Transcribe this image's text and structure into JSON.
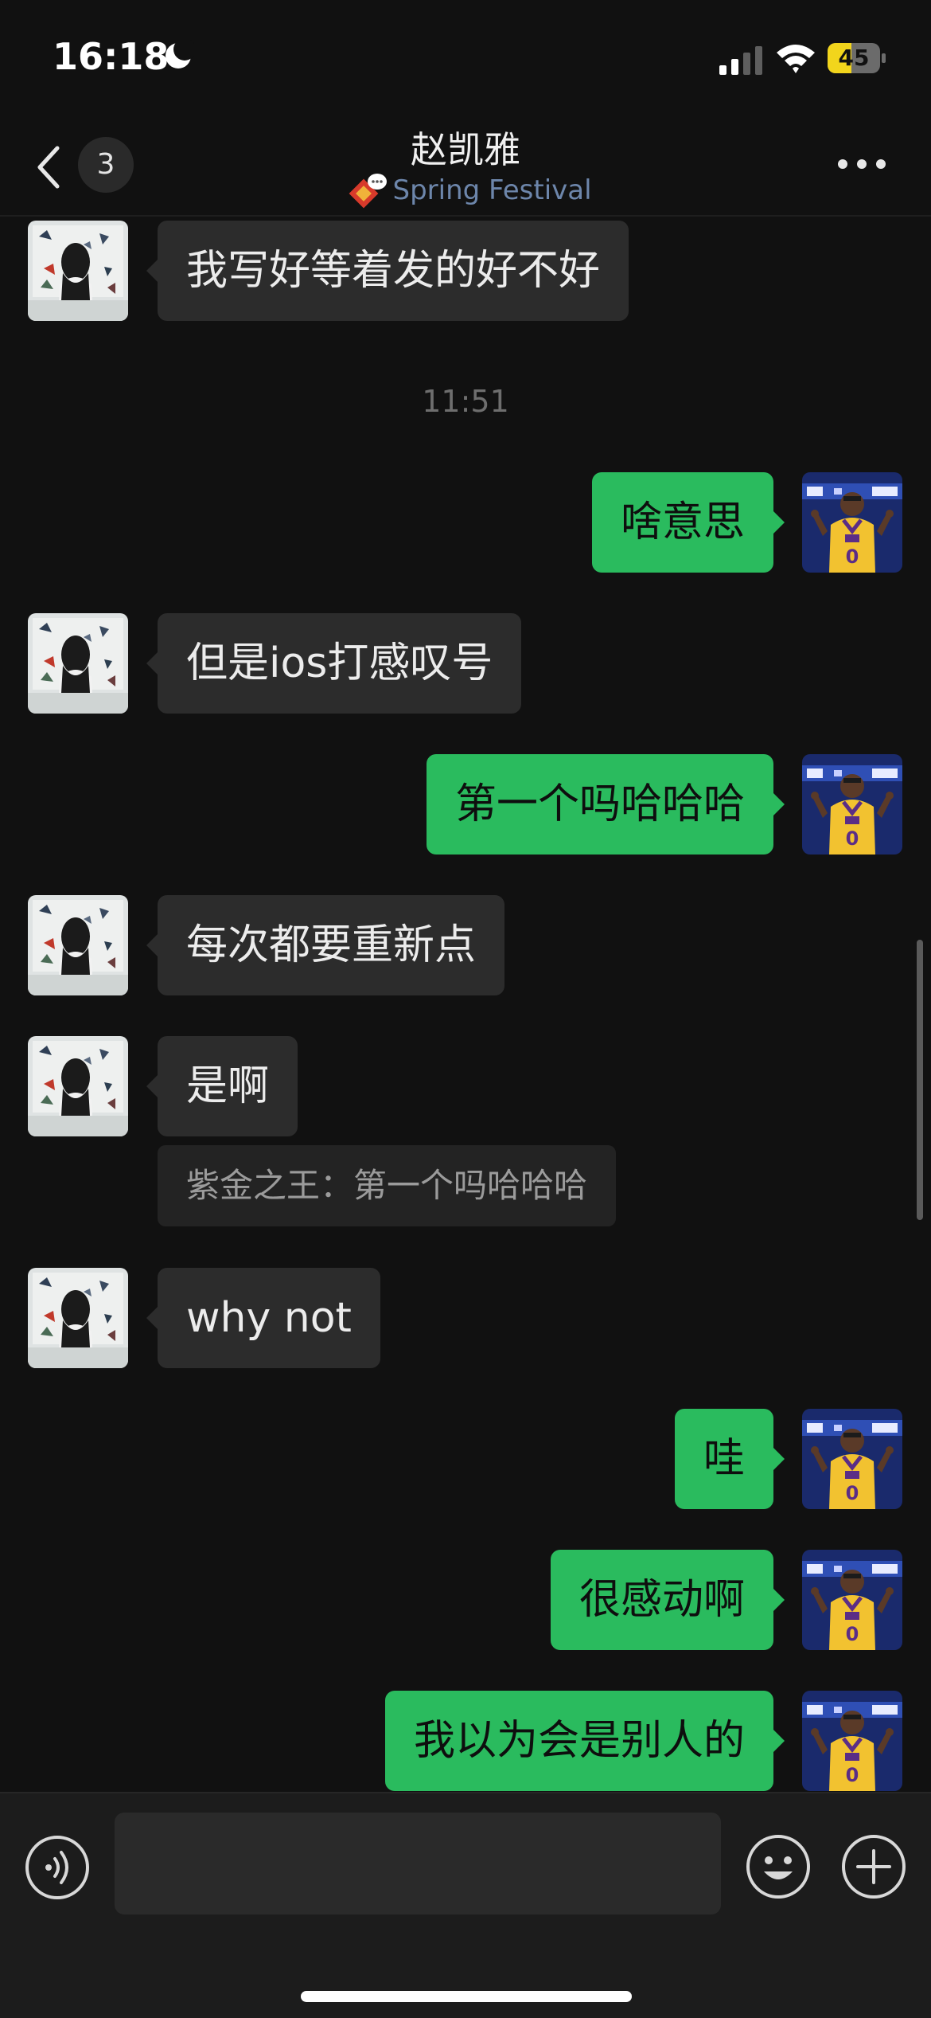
{
  "status_bar": {
    "time": "16:18",
    "battery": "45",
    "battery_level": 0.45
  },
  "header": {
    "back_count": "3",
    "title": "赵凯雅",
    "status_text": "Spring Festival"
  },
  "messages": [
    {
      "text": "我写好等着发的好不好",
      "from": "contact"
    },
    {
      "timestamp": "11:51"
    },
    {
      "text": "啥意思",
      "from": "me"
    },
    {
      "text": "但是ios打感叹号",
      "from": "contact"
    },
    {
      "text": "第一个吗哈哈哈",
      "from": "me"
    },
    {
      "text": "每次都要重新点",
      "from": "contact"
    },
    {
      "text": "是啊",
      "from": "contact",
      "quote": "紫金之王：第一个吗哈哈哈"
    },
    {
      "text": "why not",
      "from": "contact"
    },
    {
      "text": "哇",
      "from": "me"
    },
    {
      "text": "很感动啊",
      "from": "me"
    },
    {
      "text": "我以为会是别人的",
      "from": "me"
    }
  ],
  "input_bar": {
    "placeholder": ""
  },
  "colors": {
    "background": "#111111",
    "incoming_bubble": "#2c2c2c",
    "outgoing_bubble": "#2abb5e",
    "status_text": "#6d86ab",
    "battery": "#f2d51c"
  }
}
